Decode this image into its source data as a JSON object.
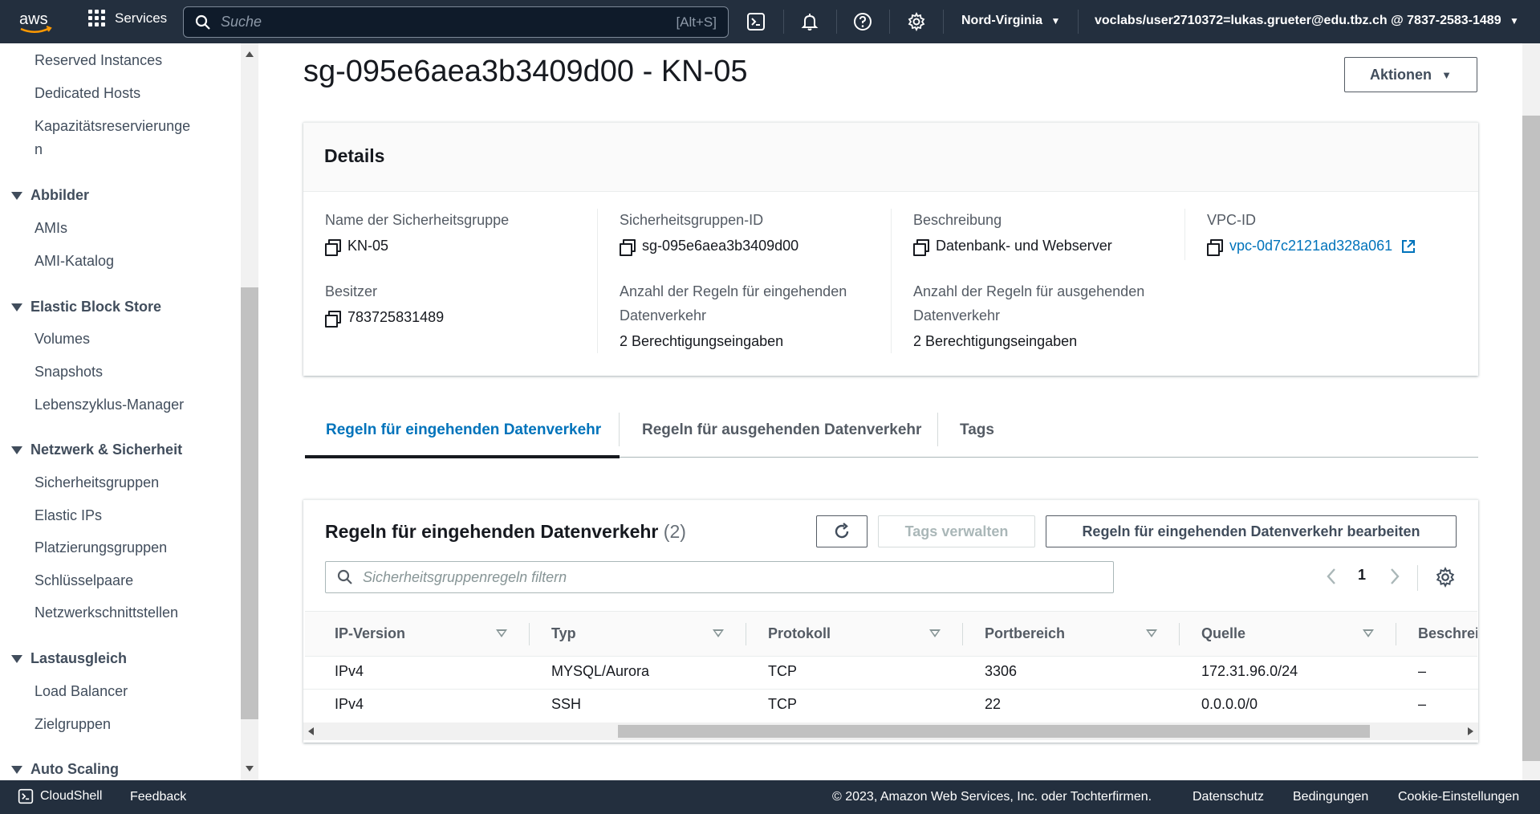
{
  "topnav": {
    "logo_text": "aws",
    "services_label": "Services",
    "search_placeholder": "Suche",
    "search_shortcut": "[Alt+S]",
    "region_label": "Nord-Virginia",
    "account_label": "voclabs/user2710372=lukas.grueter@edu.tbz.ch @ 7837-2583-1489"
  },
  "sidebar": {
    "links_top": [
      "Reserved Instances",
      "Dedicated Hosts",
      "Kapazitätsreservierunge",
      "n"
    ],
    "sections": [
      {
        "title": "Abbilder",
        "items": [
          "AMIs",
          "AMI-Katalog"
        ]
      },
      {
        "title": "Elastic Block Store",
        "items": [
          "Volumes",
          "Snapshots",
          "Lebenszyklus-Manager"
        ]
      },
      {
        "title": "Netzwerk & Sicherheit",
        "items": [
          "Sicherheitsgruppen",
          "Elastic IPs",
          "Platzierungsgruppen",
          "Schlüsselpaare",
          "Netzwerkschnittstellen"
        ]
      },
      {
        "title": "Lastausgleich",
        "items": [
          "Load Balancer",
          "Zielgruppen"
        ]
      },
      {
        "title": "Auto Scaling",
        "items": []
      }
    ]
  },
  "page": {
    "title": "sg-095e6aea3b3409d00 - KN-05",
    "actions_label": "Aktionen"
  },
  "details": {
    "heading": "Details",
    "name_label": "Name der Sicherheitsgruppe",
    "name_value": "KN-05",
    "id_label": "Sicherheitsgruppen-ID",
    "id_value": "sg-095e6aea3b3409d00",
    "desc_label": "Beschreibung",
    "desc_value": "Datenbank- und Webserver",
    "vpc_label": "VPC-ID",
    "vpc_value": "vpc-0d7c2121ad328a061",
    "owner_label": "Besitzer",
    "owner_value": "783725831489",
    "inbound_count_label_1": "Anzahl der Regeln für eingehenden",
    "inbound_count_label_2": "Datenverkehr",
    "inbound_count_value": "2 Berechtigungseingaben",
    "outbound_count_label_1": "Anzahl der Regeln für ausgehenden",
    "outbound_count_label_2": "Datenverkehr",
    "outbound_count_value": "2 Berechtigungseingaben"
  },
  "tabs": [
    "Regeln für eingehenden Datenverkehr",
    "Regeln für ausgehenden Datenverkehr",
    "Tags"
  ],
  "rules": {
    "heading": "Regeln für eingehenden Datenverkehr",
    "count": "(2)",
    "manage_tags_label": "Tags verwalten",
    "edit_label": "Regeln für eingehenden Datenverkehr bearbeiten",
    "filter_placeholder": "Sicherheitsgruppenregeln filtern",
    "page_number": "1",
    "columns": [
      "IP-Version",
      "Typ",
      "Protokoll",
      "Portbereich",
      "Quelle",
      "Beschrei"
    ],
    "rows": [
      [
        "IPv4",
        "MYSQL/Aurora",
        "TCP",
        "3306",
        "172.31.96.0/24",
        "–"
      ],
      [
        "IPv4",
        "SSH",
        "TCP",
        "22",
        "0.0.0.0/0",
        "–"
      ]
    ]
  },
  "footer": {
    "cloudshell": "CloudShell",
    "feedback": "Feedback",
    "copyright": "© 2023, Amazon Web Services, Inc. oder Tochterfirmen.",
    "privacy": "Datenschutz",
    "terms": "Bedingungen",
    "cookies": "Cookie-Einstellungen"
  },
  "colors": {
    "nav_bg": "#232f3e",
    "link": "#0073bb",
    "active_tab": "#0073bb"
  }
}
